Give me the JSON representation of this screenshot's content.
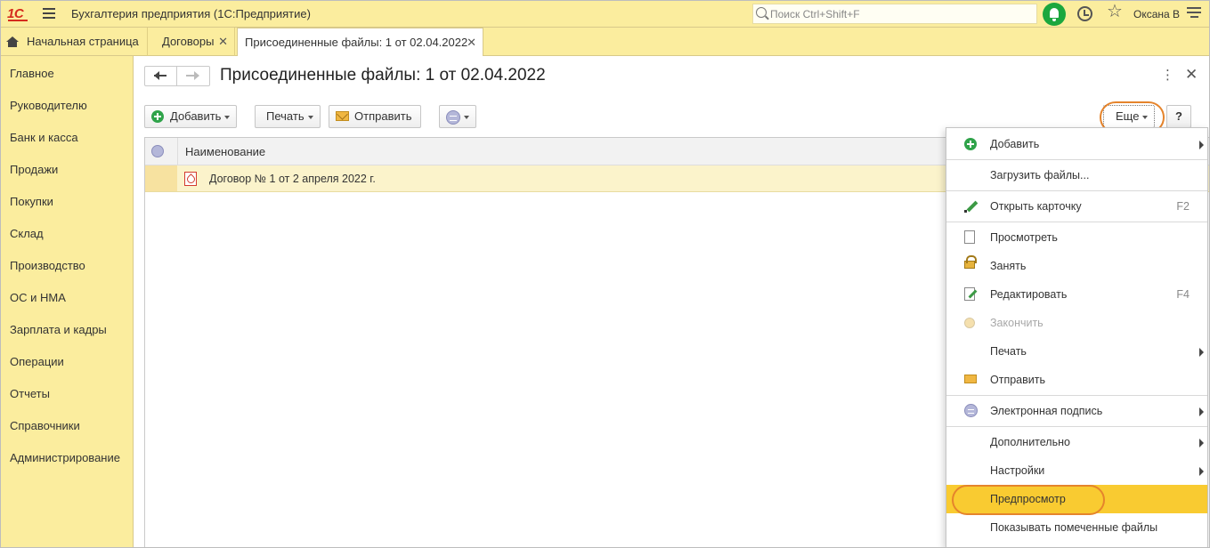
{
  "app": {
    "logo": "1С",
    "title": "Бухгалтерия предприятия  (1С:Предприятие)",
    "search_placeholder": "Поиск Ctrl+Shift+F",
    "user": "Оксана В"
  },
  "tabs": [
    {
      "label": "Начальная страница"
    },
    {
      "label": "Договоры"
    },
    {
      "label": "Присоединенные файлы: 1 от 02.04.2022"
    }
  ],
  "sidebar": {
    "items": [
      {
        "label": "Главное"
      },
      {
        "label": "Руководителю"
      },
      {
        "label": "Банк и касса"
      },
      {
        "label": "Продажи"
      },
      {
        "label": "Покупки"
      },
      {
        "label": "Склад"
      },
      {
        "label": "Производство"
      },
      {
        "label": "ОС и НМА"
      },
      {
        "label": "Зарплата и кадры"
      },
      {
        "label": "Операции"
      },
      {
        "label": "Отчеты"
      },
      {
        "label": "Справочники"
      },
      {
        "label": "Администрирование"
      }
    ]
  },
  "form": {
    "title": "Присоединенные файлы: 1 от 02.04.2022",
    "toolbar": {
      "add": "Добавить",
      "print": "Печать",
      "send": "Отправить",
      "more": "Еще",
      "help": "?"
    },
    "table": {
      "header": "Наименование",
      "rows": [
        {
          "name": "Договор № 1 от 2 апреля 2022 г."
        }
      ]
    }
  },
  "menu": {
    "items": [
      {
        "label": "Добавить",
        "icon": "plus-icon",
        "submenu": true
      },
      {
        "label": "Загрузить файлы..."
      },
      {
        "label": "Открыть карточку",
        "icon": "pencil-icon",
        "shortcut": "F2"
      },
      {
        "label": "Просмотреть",
        "icon": "page-icon"
      },
      {
        "label": "Занять",
        "icon": "lock-icon"
      },
      {
        "label": "Редактировать",
        "icon": "edit-icon",
        "shortcut": "F4"
      },
      {
        "label": "Закончить",
        "icon": "finish-icon",
        "disabled": true
      },
      {
        "label": "Печать",
        "submenu": true
      },
      {
        "label": "Отправить",
        "icon": "envelope-icon"
      },
      {
        "label": "Электронная подпись",
        "icon": "signature-icon",
        "submenu": true
      },
      {
        "label": "Дополнительно",
        "submenu": true
      },
      {
        "label": "Настройки",
        "submenu": true
      },
      {
        "label": "Предпросмотр",
        "active": true
      },
      {
        "label": "Показывать помеченные файлы"
      }
    ]
  },
  "colors": {
    "panel": "#fbed9e",
    "selected_row": "#fbf3cb",
    "active_menu_item": "#f9cb31",
    "highlight_outline": "#e5842c"
  }
}
